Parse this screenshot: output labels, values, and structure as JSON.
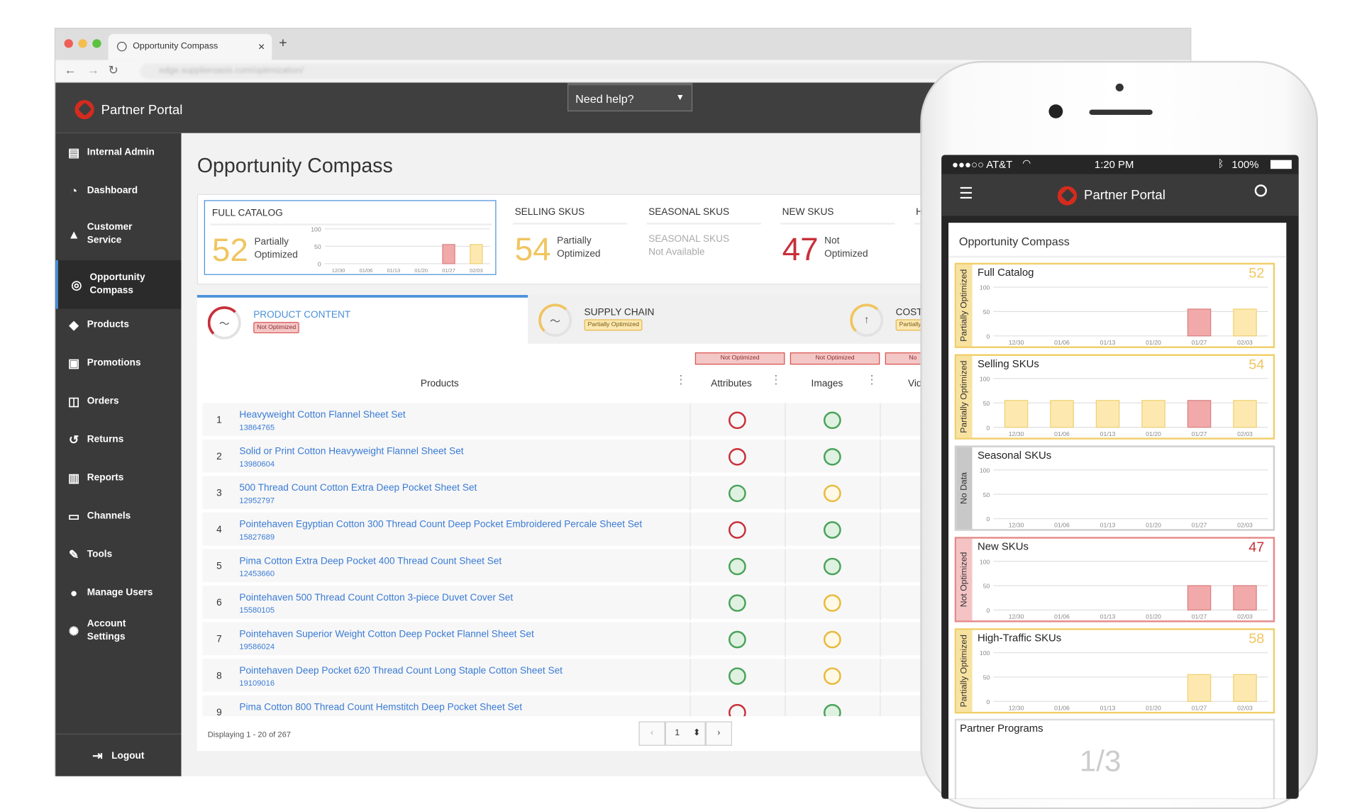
{
  "browser": {
    "tab_title": "Opportunity Compass",
    "tab_close": "×",
    "new_tab": "+",
    "url": "edge.supplieroasis.com/optimization/"
  },
  "app": {
    "logo_text": "Partner Portal",
    "help_label": "Need help?"
  },
  "sidebar": {
    "items": [
      {
        "label": "Internal Admin",
        "icon": "clipboard-icon",
        "glyph": "▤"
      },
      {
        "label": "Dashboard",
        "icon": "gauge-icon",
        "glyph": "◔"
      },
      {
        "label": "Customer Service",
        "icon": "warning-icon",
        "glyph": "▲"
      },
      {
        "label": "Opportunity Compass",
        "icon": "compass-icon",
        "glyph": "◎"
      },
      {
        "label": "Products",
        "icon": "tag-icon",
        "glyph": "◆"
      },
      {
        "label": "Promotions",
        "icon": "ticket-icon",
        "glyph": "▣"
      },
      {
        "label": "Orders",
        "icon": "inbox-icon",
        "glyph": "◫"
      },
      {
        "label": "Returns",
        "icon": "return-icon",
        "glyph": "↺"
      },
      {
        "label": "Reports",
        "icon": "bar-chart-icon",
        "glyph": "▥"
      },
      {
        "label": "Channels",
        "icon": "monitor-icon",
        "glyph": "▭"
      },
      {
        "label": "Tools",
        "icon": "wrench-icon",
        "glyph": "✎"
      },
      {
        "label": "Manage Users",
        "icon": "users-icon",
        "glyph": "●"
      },
      {
        "label": "Account Settings",
        "icon": "gear-icon",
        "glyph": "✺"
      }
    ],
    "active_index": 3,
    "logout": "Logout"
  },
  "main": {
    "title": "Opportunity Compass",
    "summary": [
      {
        "title": "FULL CATALOG",
        "value": "52",
        "status": [
          "Partially",
          "Optimized"
        ],
        "color": "#f0c560"
      },
      {
        "title": "SELLING SKUS",
        "value": "54",
        "status": [
          "Partially",
          "Optimized"
        ],
        "color": "#f0c560"
      },
      {
        "title": "SEASONAL SKUS",
        "na": [
          "SEASONAL SKUS",
          "Not Available"
        ]
      },
      {
        "title": "NEW SKUS",
        "value": "47",
        "status": [
          "Not",
          "Optimized"
        ],
        "color": "#c9303a"
      },
      {
        "title": "H"
      }
    ],
    "mini_chart": {
      "ticks": [
        "100",
        "50",
        "0"
      ],
      "dates": [
        "12/30",
        "01/06",
        "01/13",
        "01/20",
        "01/27",
        "02/03"
      ]
    },
    "tabs": [
      {
        "name": "PRODUCT CONTENT",
        "badge": "Not Optimized",
        "icon": "trend-gauge-icon"
      },
      {
        "name": "SUPPLY CHAIN",
        "badge": "Partially Optimized",
        "icon": "trend-gauge-icon"
      },
      {
        "name": "COST",
        "badge": "Partially",
        "icon": "arrow-up-gauge-icon"
      }
    ],
    "columns": {
      "products": "Products",
      "attributes": "Attributes",
      "images": "Images",
      "video": "Vid",
      "attr_badge": "Not Optimized",
      "img_badge": "Not Optimized",
      "vid_badge": "No"
    },
    "rows": [
      {
        "num": "1",
        "name": "Heavyweight Cotton Flannel Sheet Set",
        "sku": "13864765",
        "attr": "red",
        "img": "green"
      },
      {
        "num": "2",
        "name": "Solid or Print Cotton Heavyweight Flannel Sheet Set",
        "sku": "13980604",
        "attr": "red",
        "img": "green"
      },
      {
        "num": "3",
        "name": "500 Thread Count Cotton Extra Deep Pocket Sheet Set",
        "sku": "12952797",
        "attr": "green",
        "img": "yellow"
      },
      {
        "num": "4",
        "name": "Pointehaven Egyptian Cotton 300 Thread Count Deep Pocket Embroidered Percale Sheet Set",
        "sku": "15827689",
        "attr": "red",
        "img": "green"
      },
      {
        "num": "5",
        "name": "Pima Cotton Extra Deep Pocket 400 Thread Count Sheet Set",
        "sku": "12453660",
        "attr": "green",
        "img": "green"
      },
      {
        "num": "6",
        "name": "Pointehaven 500 Thread Count Cotton 3-piece Duvet Cover Set",
        "sku": "15580105",
        "attr": "green",
        "img": "yellow"
      },
      {
        "num": "7",
        "name": "Pointehaven Superior Weight Cotton Deep Pocket Flannel Sheet Set",
        "sku": "19586024",
        "attr": "green",
        "img": "yellow"
      },
      {
        "num": "8",
        "name": "Pointehaven Deep Pocket 620 Thread Count Long Staple Cotton Sheet Set",
        "sku": "19109016",
        "attr": "green",
        "img": "yellow"
      },
      {
        "num": "9",
        "name": "Pima Cotton 800 Thread Count Hemstitch Deep Pocket Sheet Set",
        "sku": "",
        "attr": "red",
        "img": "green"
      }
    ],
    "footer": "Displaying 1 - 20 of 267",
    "pager": {
      "prev": "‹",
      "page": "1",
      "next": "›",
      "updown": "⬍"
    }
  },
  "phone": {
    "carrier": "●●●○○ AT&T",
    "time": "1:20 PM",
    "battery": "100%",
    "logo_text": "Partner Portal",
    "title": "Opportunity Compass",
    "cards": [
      {
        "title": "Full Catalog",
        "value": "52",
        "side": "Partially Optimized",
        "kind": "part",
        "bars": [
          0,
          0,
          0,
          0,
          55,
          55
        ],
        "barcolors": [
          "",
          "",
          "",
          "",
          "red",
          "yellow"
        ]
      },
      {
        "title": "Selling SKUs",
        "value": "54",
        "side": "Partially Optimized",
        "kind": "part",
        "bars": [
          55,
          55,
          55,
          55,
          55,
          55
        ],
        "barcolors": [
          "yellow",
          "yellow",
          "yellow",
          "yellow",
          "red",
          "yellow"
        ]
      },
      {
        "title": "Seasonal SKUs",
        "value": "",
        "side": "No Data",
        "kind": "nd",
        "bars": [
          0,
          0,
          0,
          0,
          0,
          0
        ],
        "barcolors": [
          "",
          "",
          "",
          "",
          "",
          ""
        ]
      },
      {
        "title": "New SKUs",
        "value": "47",
        "side": "Not Optimized",
        "kind": "not",
        "bars": [
          0,
          0,
          0,
          0,
          50,
          50
        ],
        "barcolors": [
          "",
          "",
          "",
          "",
          "red",
          "red"
        ]
      },
      {
        "title": "High-Traffic SKUs",
        "value": "58",
        "side": "Partially Optimized",
        "kind": "part",
        "bars": [
          0,
          0,
          0,
          0,
          55,
          55
        ],
        "barcolors": [
          "",
          "",
          "",
          "",
          "yellow",
          "yellow"
        ]
      }
    ],
    "programs_title": "Partner Programs",
    "programs_value": "1/3"
  },
  "colors": {
    "accent": "#4a90d9",
    "red": "#c9303a",
    "green": "#4aa35a",
    "yellow": "#f0c560",
    "bar_red": "#f2a9a9",
    "bar_yellow": "#fde9b0"
  }
}
